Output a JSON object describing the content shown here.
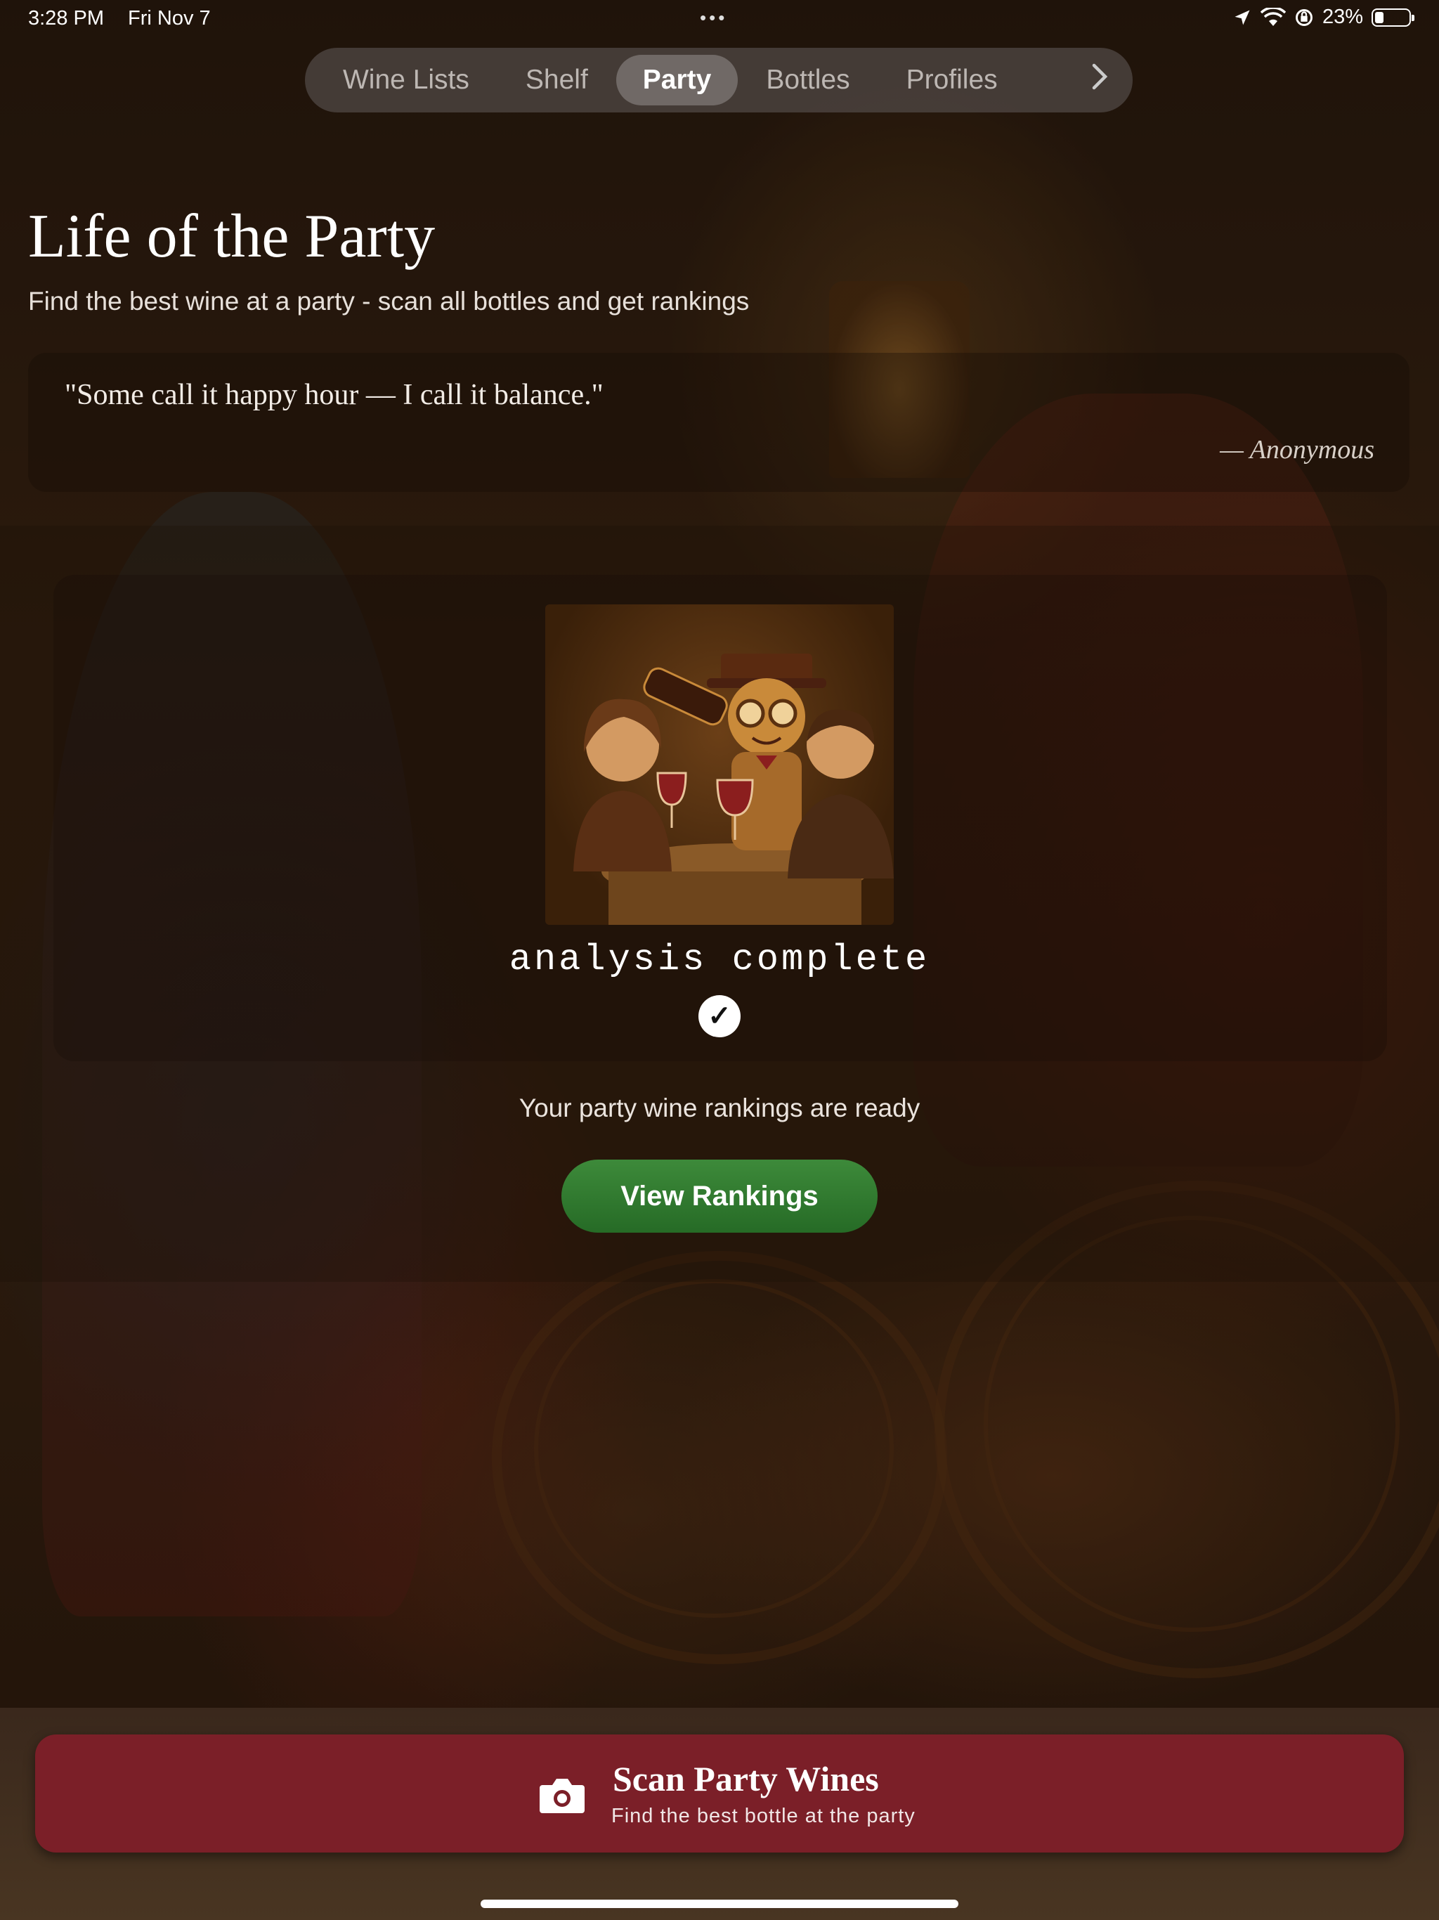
{
  "status_bar": {
    "time": "3:28 PM",
    "date": "Fri Nov 7",
    "dots": "•••",
    "battery": "23%"
  },
  "tabs": {
    "items": [
      "Wine Lists",
      "Shelf",
      "Party",
      "Bottles",
      "Profiles"
    ],
    "active": "Party",
    "more_icon": "chevron-right-icon"
  },
  "header": {
    "title": "Life of the Party",
    "subtitle": "Find the best wine at a party - scan all bottles and get rankings"
  },
  "quote": {
    "text": "\"Some call it happy hour — I call it balance.\"",
    "author": "— Anonymous"
  },
  "analysis": {
    "status": "analysis complete",
    "message": "Your party wine rankings are ready",
    "button_label": "View Rankings"
  },
  "scan": {
    "title": "Scan Party Wines",
    "subtitle": "Find the best bottle at the party",
    "icon": "camera-icon"
  },
  "colors": {
    "accent_green": "#2f7a2f",
    "scan_red": "#7b1f28"
  }
}
